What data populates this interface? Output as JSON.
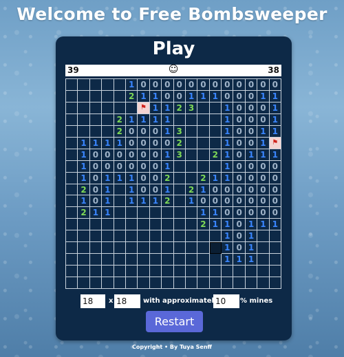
{
  "page": {
    "title": "Welcome to Free Bombsweeper"
  },
  "game": {
    "heading": "Play",
    "status": {
      "left_count": "39",
      "face": "☺",
      "right_count": "38"
    },
    "grid_size": 18,
    "board": [
      [
        "",
        "",
        "",
        "",
        "",
        "1",
        "0",
        "0",
        "0",
        "0",
        "0",
        "0",
        "0",
        "0",
        "0",
        "0",
        "0",
        "0"
      ],
      [
        "",
        "",
        "",
        "",
        "",
        "2",
        "1",
        "1",
        "0",
        "0",
        "1",
        "1",
        "1",
        "0",
        "0",
        "0",
        "1",
        "1"
      ],
      [
        "",
        "",
        "",
        "",
        "",
        "",
        "F",
        "1",
        "1",
        "2",
        "3",
        "",
        "",
        "1",
        "0",
        "0",
        "0",
        "1"
      ],
      [
        "",
        "",
        "",
        "",
        "2",
        "1",
        "1",
        "1",
        "1",
        "",
        "",
        "",
        "",
        "1",
        "0",
        "0",
        "0",
        "1"
      ],
      [
        "",
        "",
        "",
        "",
        "2",
        "0",
        "0",
        "0",
        "1",
        "3",
        "",
        "",
        "",
        "1",
        "0",
        "0",
        "1",
        "1"
      ],
      [
        "",
        "1",
        "1",
        "1",
        "1",
        "0",
        "0",
        "0",
        "0",
        "2",
        "",
        "",
        "",
        "1",
        "0",
        "0",
        "1",
        "F"
      ],
      [
        "",
        "1",
        "0",
        "0",
        "0",
        "0",
        "0",
        "0",
        "1",
        "3",
        "",
        "",
        "2",
        "1",
        "0",
        "1",
        "1",
        "1"
      ],
      [
        "",
        "1",
        "0",
        "0",
        "0",
        "0",
        "0",
        "0",
        "1",
        "",
        "",
        "",
        "",
        "1",
        "0",
        "0",
        "0",
        "0"
      ],
      [
        "",
        "1",
        "0",
        "1",
        "1",
        "1",
        "0",
        "0",
        "2",
        "",
        "",
        "2",
        "1",
        "1",
        "0",
        "0",
        "0",
        "0"
      ],
      [
        "",
        "2",
        "0",
        "1",
        "",
        "1",
        "0",
        "0",
        "1",
        "",
        "2",
        "1",
        "0",
        "0",
        "0",
        "0",
        "0",
        "0"
      ],
      [
        "",
        "1",
        "0",
        "1",
        "",
        "1",
        "1",
        "1",
        "2",
        "",
        "1",
        "0",
        "0",
        "0",
        "0",
        "0",
        "0",
        "0"
      ],
      [
        "",
        "2",
        "1",
        "1",
        "",
        "",
        "",
        "",
        "",
        "",
        "",
        "1",
        "1",
        "0",
        "0",
        "0",
        "0",
        "0"
      ],
      [
        "",
        "",
        "",
        "",
        "",
        "",
        "",
        "",
        "",
        "",
        "",
        "2",
        "1",
        "1",
        "0",
        "1",
        "1",
        "1"
      ],
      [
        "",
        "",
        "",
        "",
        "",
        "",
        "",
        "",
        "",
        "",
        "",
        "",
        "",
        "1",
        "0",
        "1",
        "",
        "",
        ""
      ],
      [
        "",
        "",
        "",
        "",
        "",
        "",
        "",
        "",
        "",
        "",
        "",
        "",
        "S",
        "1",
        "0",
        "1",
        "",
        ""
      ],
      [
        "",
        "",
        "",
        "",
        "",
        "",
        "",
        "",
        "",
        "",
        "",
        "",
        "",
        "1",
        "1",
        "1",
        "",
        ""
      ],
      [
        "",
        "",
        "",
        "",
        "",
        "",
        "",
        "",
        "",
        "",
        "",
        "",
        "",
        "",
        "",
        "",
        "",
        ""
      ],
      [
        "",
        "",
        "",
        "",
        "",
        "",
        "",
        "",
        "",
        "",
        "",
        "",
        "",
        "",
        "",
        "",
        "",
        ""
      ]
    ],
    "options": {
      "rows_value": "18",
      "times_label": "x",
      "cols_value": "18",
      "with_label": "with approximately",
      "percent_value": "10",
      "percent_label": "% mines"
    },
    "restart_label": "Restart"
  },
  "footer": {
    "text": "Copyright • By Tuya Senff"
  }
}
